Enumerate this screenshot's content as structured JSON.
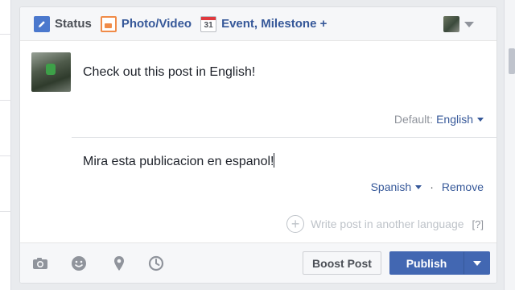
{
  "tabs": [
    {
      "label": "Status",
      "icon": "pencil-icon"
    },
    {
      "label": "Photo/Video",
      "icon": "photo-icon"
    },
    {
      "label": "Event, Milestone +",
      "icon": "calendar-icon",
      "day": "31"
    }
  ],
  "post": {
    "primary_text": "Check out this post in English!",
    "default_label": "Default:",
    "default_language": "English",
    "translation_text": "Mira esta publicacion en espanol!",
    "translation_language": "Spanish",
    "remove_label": "Remove",
    "separator": "·",
    "add_language_label": "Write post in another language",
    "help_label": "[?]"
  },
  "footer": {
    "icons": [
      "camera-icon",
      "smiley-icon",
      "location-pin-icon",
      "clock-icon"
    ],
    "boost_label": "Boost Post",
    "publish_label": "Publish"
  },
  "colors": {
    "link": "#365899",
    "primary_button": "#4267b2",
    "muted": "#90949c"
  }
}
